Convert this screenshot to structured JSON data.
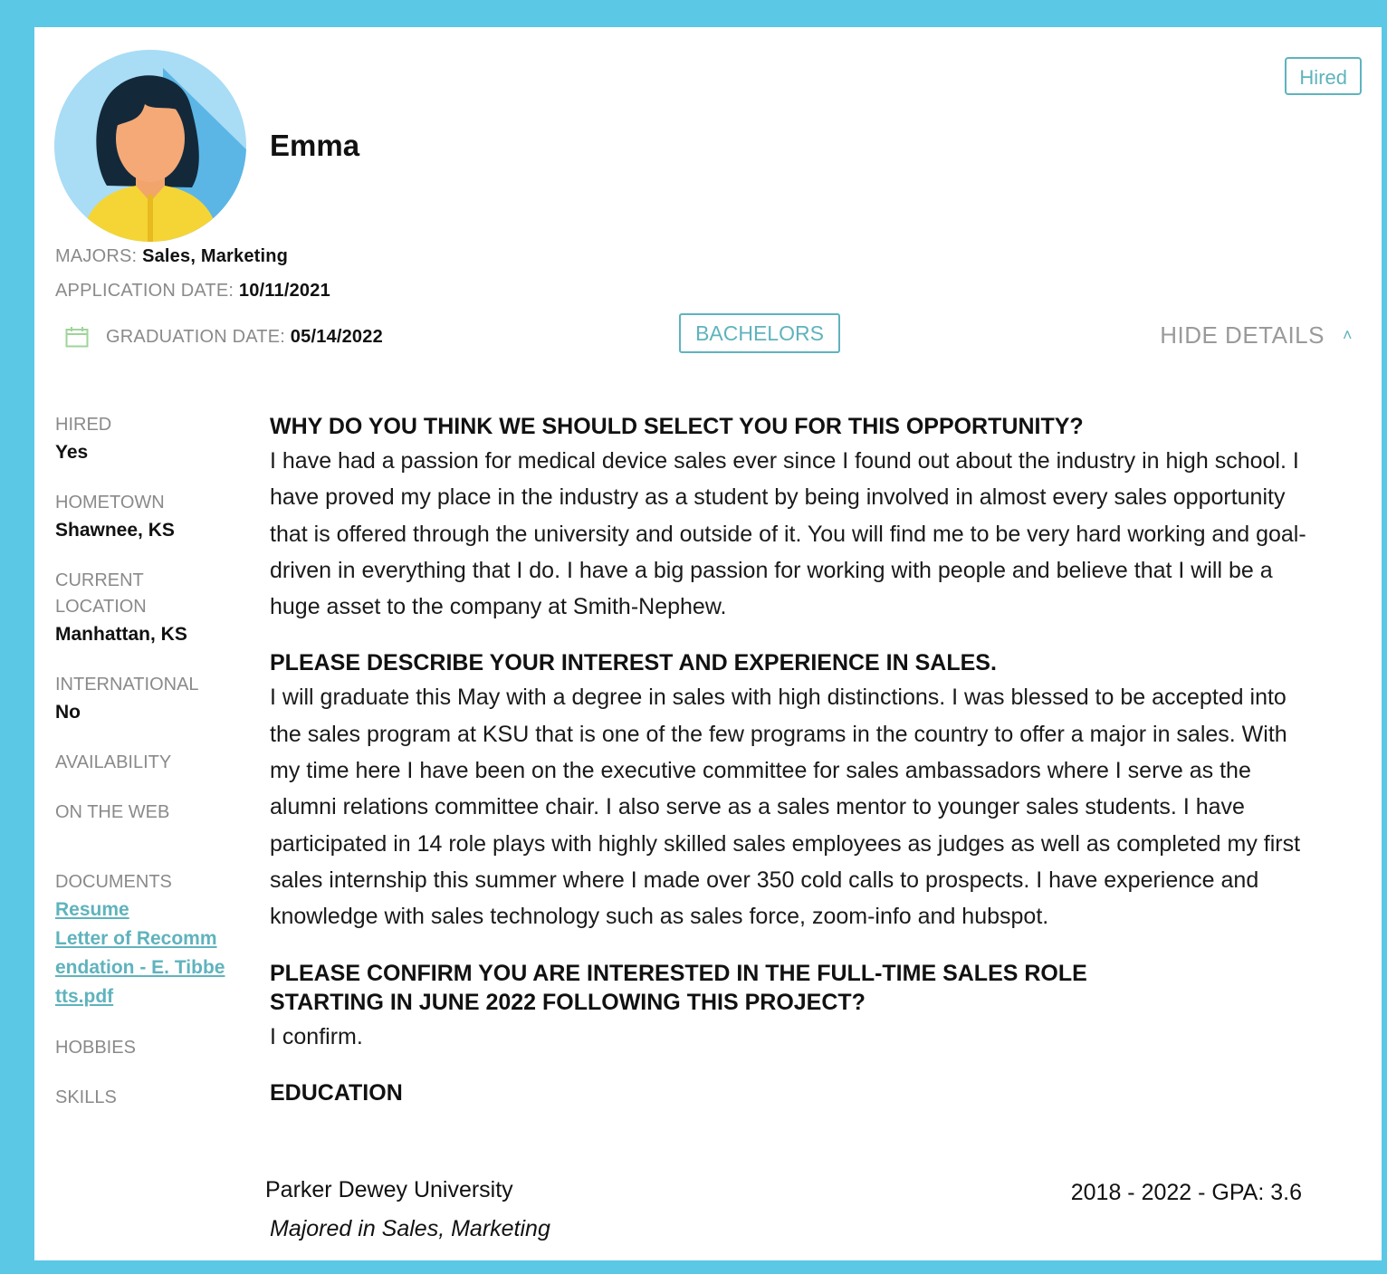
{
  "candidate": {
    "name": "Emma",
    "status_badge": "Hired",
    "majors_label": "MAJORS:",
    "majors_value": "Sales, Marketing",
    "application_date_label": "APPLICATION DATE:",
    "application_date_value": "10/11/2021",
    "graduation_date_label": "GRADUATION DATE:",
    "graduation_date_value": "05/14/2022",
    "degree_badge": "BACHELORS",
    "hide_details": "HIDE DETAILS"
  },
  "sidebar": {
    "hired_label": "HIRED",
    "hired_value": "Yes",
    "hometown_label": "HOMETOWN",
    "hometown_value": "Shawnee, KS",
    "current_location_label": "CURRENT LOCATION",
    "current_location_value": "Manhattan, KS",
    "international_label": "INTERNATIONAL",
    "international_value": "No",
    "availability_label": "AVAILABILITY",
    "on_the_web_label": "ON THE WEB",
    "documents_label": "DOCUMENTS",
    "documents": [
      "Resume",
      "Letter of Recommendation - E. Tibbetts.pdf"
    ],
    "hobbies_label": "HOBBIES",
    "skills_label": "SKILLS"
  },
  "questions": [
    {
      "question": "WHY DO YOU THINK WE SHOULD SELECT YOU FOR THIS OPPORTUNITY?",
      "answer": "I have had a passion for medical device sales ever since I found out about the industry in high school. I have proved my place in the industry as a student by being involved in almost every sales opportunity that is offered through the university and outside of it. You will find me to be very hard working and goal-driven in everything that I do. I have a big passion for working with people and believe that I will be a huge asset to the company at Smith-Nephew."
    },
    {
      "question": "PLEASE DESCRIBE YOUR INTEREST AND EXPERIENCE IN SALES.",
      "answer": "I will graduate this May with a degree in sales with high distinctions. I was blessed to be accepted into the sales program at KSU that is one of the few programs in the country to offer a major in sales. With my time here I have been on the executive committee for sales ambassadors where I serve as the alumni relations committee chair. I also serve as a sales mentor to younger sales students. I have participated in 14 role plays with highly skilled sales employees as judges as well as completed my first sales internship this summer where I made over 350 cold calls to prospects. I have experience and knowledge with sales technology such as sales force, zoom-info and hubspot."
    },
    {
      "question": "PLEASE CONFIRM YOU ARE INTERESTED IN THE FULL-TIME SALES ROLE STARTING IN JUNE 2022 FOLLOWING THIS PROJECT?",
      "answer": "I confirm."
    }
  ],
  "education": {
    "heading": "EDUCATION",
    "school": "Parker Dewey University",
    "years_gpa": "2018 - 2022 - GPA: 3.6",
    "major": "Majored in Sales, Marketing"
  },
  "colors": {
    "frame": "#5bc8e6",
    "accent": "#5fb3bd",
    "muted_text": "#8a8a8a"
  }
}
